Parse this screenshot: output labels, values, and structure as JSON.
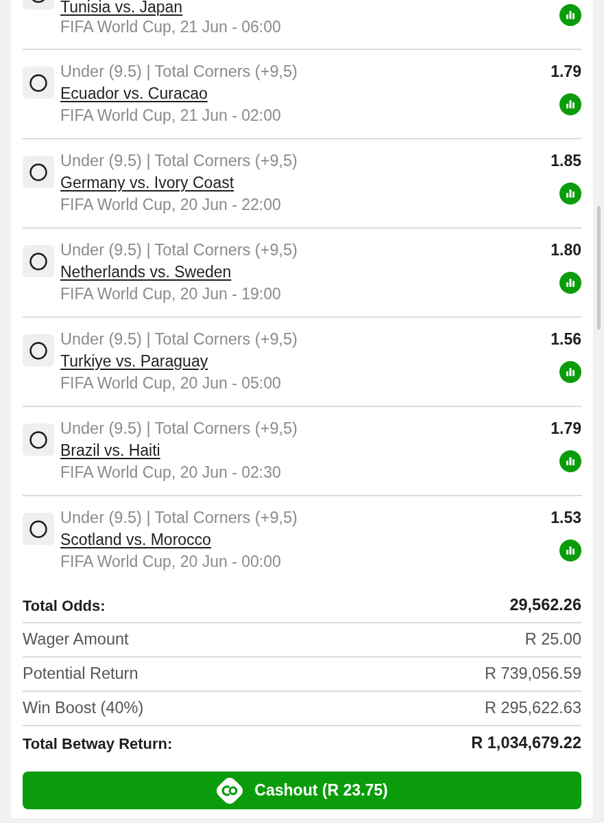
{
  "selections": [
    {
      "kind": "partial",
      "settled": false,
      "match": "Tunisia vs. Japan",
      "event": "FIFA World Cup, 21 Jun - 06:00"
    },
    {
      "kind": "full",
      "settled": false,
      "market": "Under (9.5) | Total Corners (+9,5)",
      "match": "Ecuador vs. Curacao",
      "event": "FIFA World Cup, 21 Jun - 02:00",
      "odds": "1.79"
    },
    {
      "kind": "full",
      "settled": false,
      "market": "Under (9.5) | Total Corners (+9,5)",
      "match": "Germany vs. Ivory Coast",
      "event": "FIFA World Cup, 20 Jun - 22:00",
      "odds": "1.85"
    },
    {
      "kind": "full",
      "settled": false,
      "market": "Under (9.5) | Total Corners (+9,5)",
      "match": "Netherlands vs. Sweden",
      "event": "FIFA World Cup, 20 Jun - 19:00",
      "odds": "1.80"
    },
    {
      "kind": "full",
      "settled": false,
      "market": "Under (9.5) | Total Corners (+9,5)",
      "match": "Turkiye vs. Paraguay",
      "event": "FIFA World Cup, 20 Jun - 05:00",
      "odds": "1.56"
    },
    {
      "kind": "full",
      "settled": false,
      "market": "Under (9.5) | Total Corners (+9,5)",
      "match": "Brazil vs. Haiti",
      "event": "FIFA World Cup, 20 Jun - 02:30",
      "odds": "1.79"
    },
    {
      "kind": "full",
      "settled": false,
      "market": "Under (9.5) | Total Corners (+9,5)",
      "match": "Scotland vs. Morocco",
      "event": "FIFA World Cup, 20 Jun - 00:00",
      "odds": "1.53"
    }
  ],
  "summary": [
    {
      "kind": "total",
      "label": "Total Odds:",
      "value": "29,562.26"
    },
    {
      "kind": "line",
      "label": "Wager Amount",
      "value": "R 25.00"
    },
    {
      "kind": "line",
      "label": "Potential Return",
      "value": "R 739,056.59"
    },
    {
      "kind": "line",
      "label": "Win Boost (40%)",
      "value": "R 295,622.63"
    },
    {
      "kind": "total",
      "label": "Total Betway Return:",
      "value": "R 1,034,679.22"
    }
  ],
  "cashout_button": {
    "label": "Cashout (R 23.75)"
  }
}
